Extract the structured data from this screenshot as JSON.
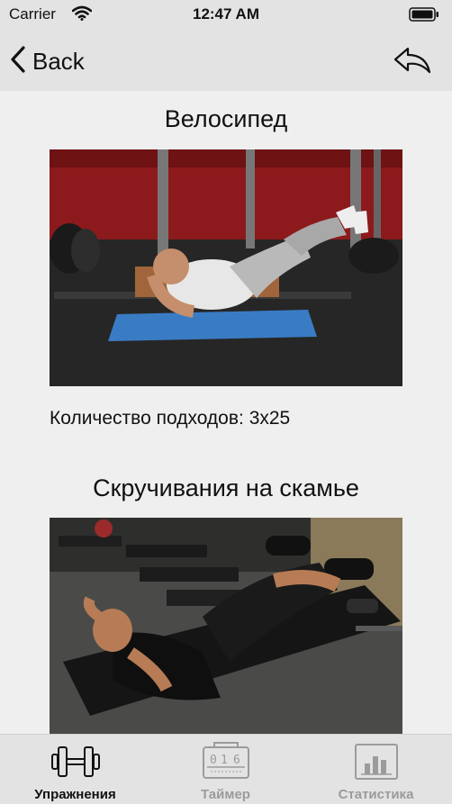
{
  "status": {
    "carrier": "Carrier",
    "time": "12:47 AM"
  },
  "nav": {
    "back_label": "Back"
  },
  "exercises": [
    {
      "title": "Велосипед",
      "sets_label": "Количество подходов: 3x25"
    },
    {
      "title": "Скручивания на скамье"
    }
  ],
  "tabs": [
    {
      "label": "Упражнения",
      "active": true
    },
    {
      "label": "Таймер",
      "active": false
    },
    {
      "label": "Статистика",
      "active": false
    }
  ],
  "colors": {
    "active_tab": "#111111",
    "inactive_tab": "#9b9b9b",
    "bar_background": "#e3e3e3"
  }
}
